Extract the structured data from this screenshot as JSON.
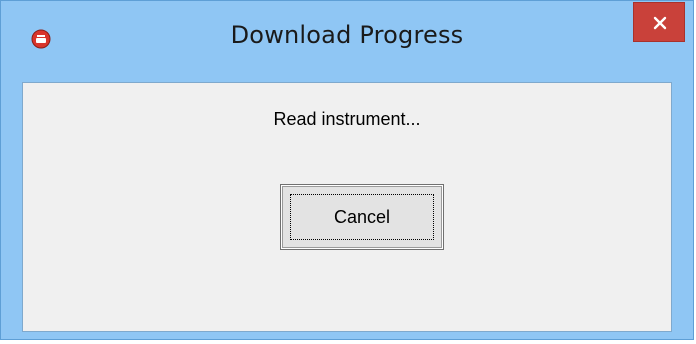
{
  "window": {
    "title": "Download Progress",
    "title_bar_color": "#8fc6f4",
    "close_button_color": "#c9413a",
    "close_icon": "close-icon",
    "app_icon": "app-icon"
  },
  "dialog": {
    "status_text": "Read instrument...",
    "cancel_label": "Cancel"
  }
}
